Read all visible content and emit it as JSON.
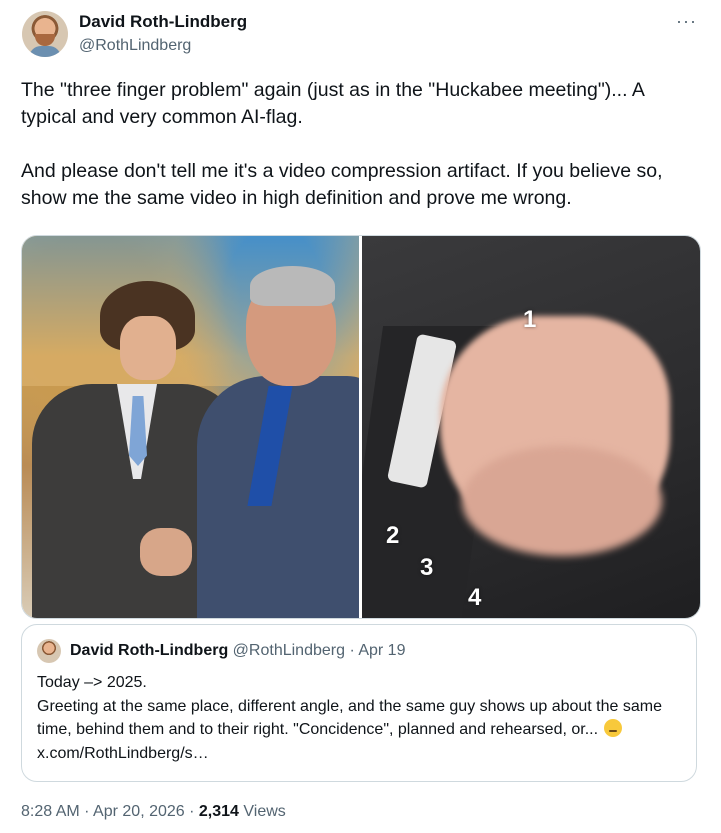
{
  "author": {
    "name": "David Roth-Lindberg",
    "handle": "@RothLindberg"
  },
  "more_icon": "···",
  "tweet": {
    "text": "The \"three finger problem\" again (just as in the \"Huckabee meeting\")... A typical and very common AI-flag.\n\nAnd please don't tell me it's a video compression artifact. If you believe so, show me the same video in high definition and prove me wrong."
  },
  "media": {
    "annotations": [
      "1",
      "2",
      "3",
      "4"
    ]
  },
  "quote": {
    "name": "David Roth-Lindberg",
    "handle": "@RothLindberg",
    "separator": "·",
    "date": "Apr 19",
    "text_before": "Today –> 2025.\nGreeting at the same place, different angle, and the same guy shows up about the same time, behind them and to their right. \"Concidence\", planned and rehearsed, or... ",
    "link": "x.com/RothLindberg/s…",
    "emoji": "thinking-face"
  },
  "footer": {
    "time": "8:28 AM",
    "sep1": "·",
    "date": "Apr 20, 2026",
    "sep2": "·",
    "views_count": "2,314",
    "views_label": "Views"
  }
}
